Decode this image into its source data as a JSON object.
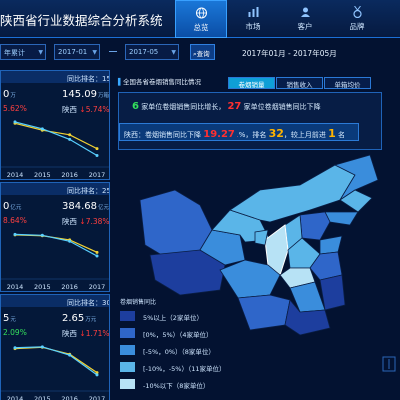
{
  "header": {
    "title": "陕西省行业数据综合分析系统",
    "nav": [
      {
        "label": "总览",
        "icon": "globe-icon",
        "active": true
      },
      {
        "label": "市场",
        "icon": "bar-chart-icon",
        "active": false
      },
      {
        "label": "客户",
        "icon": "user-icon",
        "active": false
      },
      {
        "label": "品牌",
        "icon": "medal-icon",
        "active": false
      }
    ]
  },
  "filters": {
    "period_type": "年累计",
    "start_month": "2017-01",
    "end_month": "2017-05",
    "query_label": "查询",
    "range_text": "2017年01月 - 2017年05月"
  },
  "cards": [
    {
      "rank_text": "同比排名：15 (",
      "rank_change": "↓ 1",
      "rank_close": ")",
      "left_value": "0",
      "left_unit": "万",
      "right_value": "145.09",
      "right_unit": "万箱",
      "left_pct": "5.62%",
      "right_label": "陕西",
      "right_pct": "5.74%",
      "x_labels": [
        "2014",
        "2015",
        "2016",
        "2017"
      ],
      "series": [
        {
          "name": "",
          "color": "#f2d233",
          "values": [
            95,
            80,
            70,
            40
          ]
        },
        {
          "name": "",
          "color": "#59d0ff",
          "values": [
            98,
            83,
            60,
            25
          ]
        }
      ]
    },
    {
      "rank_text": "同比排名：25 (",
      "rank_change": "↓ 1",
      "rank_close": ")",
      "left_value": "0",
      "left_unit": "亿元",
      "right_value": "384.68",
      "right_unit": "亿元",
      "left_pct": "8.64%",
      "right_label": "陕西",
      "right_pct": "7.38%",
      "x_labels": [
        "2014",
        "2015",
        "2016",
        "2017"
      ],
      "series": [
        {
          "name": "",
          "color": "#f2d233",
          "values": [
            96,
            94,
            85,
            58
          ]
        },
        {
          "name": "",
          "color": "#59d0ff",
          "values": [
            97,
            95,
            82,
            50
          ]
        }
      ]
    },
    {
      "rank_text": "同比排名：30 (",
      "rank_change": "↑ 1",
      "rank_close": ")",
      "left_value": "5",
      "left_unit": "元",
      "right_value": "2.65",
      "right_unit": "万元",
      "left_pct": "2.09%",
      "right_label": "陕西",
      "right_pct": "1.71%",
      "x_labels": [
        "2014",
        "2015",
        "2016",
        "2017"
      ],
      "series": [
        {
          "name": "",
          "color": "#f2d233",
          "values": [
            92,
            95,
            80,
            40
          ]
        },
        {
          "name": "",
          "color": "#59d0ff",
          "values": [
            94,
            96,
            78,
            35
          ]
        }
      ]
    }
  ],
  "panel": {
    "title": "全国各省卷烟销售同比情况",
    "tabs": [
      {
        "label": "卷烟销量",
        "active": true
      },
      {
        "label": "销售收入",
        "active": false
      },
      {
        "label": "单箱均价",
        "active": false
      }
    ]
  },
  "summary": {
    "up_count": "6",
    "up_text": "家单位卷烟销售同比增长，",
    "down_count": "27",
    "down_text": "家单位卷烟销售同比下降",
    "shaanxi_prefix": "陕西：卷烟销售同比下降",
    "shaanxi_pct": "19.27",
    "shaanxi_pct_unit": "%",
    "rank_prefix": "，排名",
    "rank_value": "32",
    "rank_mid": "，较上月前进",
    "rank_advance": "1",
    "rank_suffix": "名"
  },
  "legend": {
    "title": "卷烟销售同比",
    "items": [
      {
        "label": "5%以上（2家单位）",
        "color": "#1d3e9e"
      },
      {
        "label": "[0%，5%）（4家单位）",
        "color": "#2f66c9"
      },
      {
        "label": "[-5%，0%）（8家单位）",
        "color": "#3a8ddc"
      },
      {
        "label": "[-10%，-5%）（11家单位）",
        "color": "#5ab5e8"
      },
      {
        "label": "-10%以下（8家单位）",
        "color": "#b7e2f5"
      }
    ]
  }
}
